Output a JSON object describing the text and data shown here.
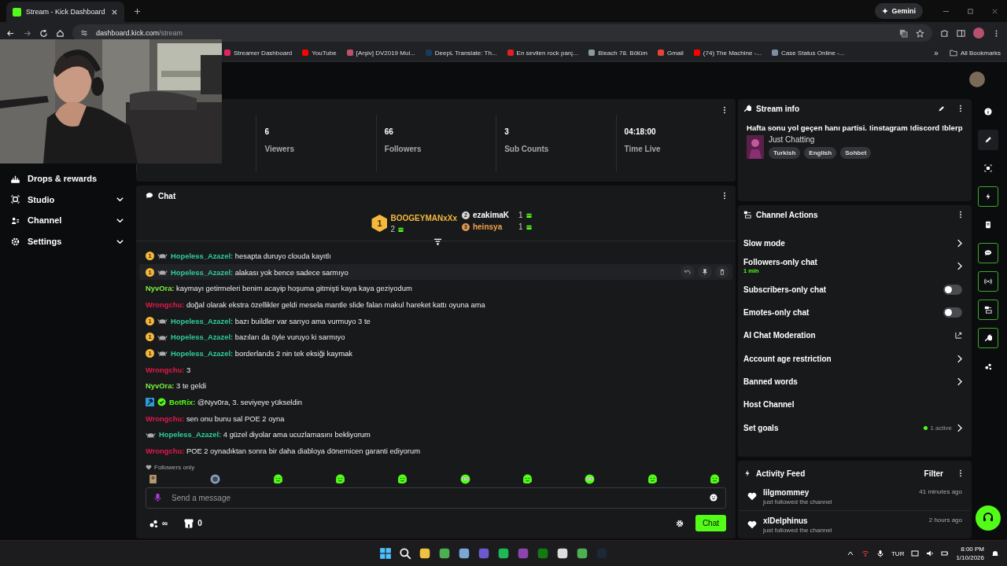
{
  "browser": {
    "tab_title": "Stream - Kick Dashboard",
    "url_host": "dashboard.kick.com",
    "url_path": "/stream",
    "gemini": "Gemini",
    "bookmarks": [
      {
        "title": "Streamer Dashboard",
        "color": "#e0245e"
      },
      {
        "title": "YouTube",
        "color": "#ff0000"
      },
      {
        "title": "[Arşiv] DV2019 Mul...",
        "color": "#c0506a"
      },
      {
        "title": "DeepL Translate: Th...",
        "color": "#1b3a5c"
      },
      {
        "title": "En sevilen rock parç...",
        "color": "#e02020"
      },
      {
        "title": "Bleach 78. Bölüm",
        "color": "#8a9aa0"
      },
      {
        "title": "Gmail",
        "color": "#ea4335"
      },
      {
        "title": "(74) The Machine -...",
        "color": "#ff0000"
      },
      {
        "title": "Case Status Online -...",
        "color": "#7a8fa6"
      }
    ],
    "more": "»",
    "all_bookmarks": "All Bookmarks"
  },
  "sidebar": [
    {
      "label": "Drops & rewards",
      "kind": "link"
    },
    {
      "label": "Studio",
      "kind": "group",
      "expanded": false
    },
    {
      "label": "Channel",
      "kind": "group",
      "expanded": false
    },
    {
      "label": "Settings",
      "kind": "group",
      "expanded": false
    }
  ],
  "stats": [
    {
      "value": "6",
      "label": "Viewers"
    },
    {
      "value": "66",
      "label": "Followers"
    },
    {
      "value": "3",
      "label": "Sub Counts"
    },
    {
      "value": "04:18:00",
      "label": "Time Live"
    }
  ],
  "chat": {
    "title": "Chat",
    "leaders": [
      {
        "rank": "1",
        "name": "BOOGEYMANxXx",
        "count": "2",
        "color": "#f5b83d"
      },
      {
        "rank": "2",
        "name": "ezakimaK",
        "count": "1",
        "color": "#ffffff"
      },
      {
        "rank": "3",
        "name": "heinsya",
        "count": "1",
        "color": "#f0a04b"
      }
    ],
    "messages": [
      {
        "sub": "1",
        "gifter": true,
        "name": "Hopeless_Azazel:",
        "color": "#2ecc9a",
        "text": "hesapta duruyo clouda kayıtlı",
        "hovered": false
      },
      {
        "sub": "1",
        "gifter": true,
        "name": "Hopeless_Azazel:",
        "color": "#2ecc9a",
        "text": "alakası yok bence sadece sarmıyo",
        "hovered": true
      },
      {
        "name": "NyvOra:",
        "color": "#7df23c",
        "text": "kaymayı getirmeleri benim acayip hoşuma gitmişti kaya kaya geziyodum",
        "hovered": false
      },
      {
        "name": "Wrongchu:",
        "color": "#e5194b",
        "text": "doğal olarak ekstra özellikler geldi mesela mantle slide falan makul hareket kattı oyuna ama",
        "hovered": false
      },
      {
        "sub": "1",
        "gifter": true,
        "name": "Hopeless_Azazel:",
        "color": "#2ecc9a",
        "text": "bazı buildler var sarıyo ama vurmuyo 3 te",
        "hovered": false
      },
      {
        "sub": "1",
        "gifter": true,
        "name": "Hopeless_Azazel:",
        "color": "#2ecc9a",
        "text": "bazıları da öyle vuruyo ki sarmıyo",
        "hovered": false
      },
      {
        "sub": "1",
        "gifter": true,
        "name": "Hopeless_Azazel:",
        "color": "#2ecc9a",
        "text": "borderlands 2 nin tek eksiği kaymak",
        "hovered": false
      },
      {
        "name": "Wrongchu:",
        "color": "#e5194b",
        "text": "3",
        "hovered": false
      },
      {
        "name": "NyvOra:",
        "color": "#7df23c",
        "text": "3 te geldi",
        "hovered": false
      },
      {
        "bot": true,
        "name": "BotRix:",
        "color": "#53fc18",
        "text": "@Nyv0ra, 3. seviyeye yükseldin",
        "hovered": false
      },
      {
        "name": "Wrongchu:",
        "color": "#e5194b",
        "text": "sen onu bunu sal POE 2 oyna",
        "hovered": false
      },
      {
        "gifter": true,
        "name": "Hopeless_Azazel:",
        "color": "#2ecc9a",
        "text": "4 güzel diyolar ama ucuzlamasını bekliyorum",
        "hovered": false
      },
      {
        "name": "Wrongchu:",
        "color": "#e5194b",
        "text": "POE 2 oynadıktan sonra bir daha diabloya dönemicen garanti ediyorum",
        "hovered": false
      }
    ],
    "restriction": "Followers only",
    "placeholder": "Send a message",
    "points": "∞",
    "store_count": "0",
    "send": "Chat"
  },
  "stream_info": {
    "title": "Stream info",
    "stream_title": "Hafta sonu yol geçen hanı partisi. !instagram !discord !blerp",
    "category": "Just Chatting",
    "tags": [
      "Turkish",
      "English",
      "Sohbet"
    ]
  },
  "channel_actions": {
    "title": "Channel Actions",
    "items": [
      {
        "label": "Slow mode",
        "kind": "link"
      },
      {
        "label": "Followers-only chat",
        "kind": "link",
        "detail": "1 min"
      },
      {
        "label": "Subscribers-only chat",
        "kind": "toggle",
        "on": false
      },
      {
        "label": "Emotes-only chat",
        "kind": "toggle",
        "on": false
      },
      {
        "label": "AI Chat Moderation",
        "kind": "external"
      },
      {
        "label": "Account age restriction",
        "kind": "link"
      },
      {
        "label": "Banned words",
        "kind": "link"
      },
      {
        "label": "Host Channel",
        "kind": "plain"
      },
      {
        "label": "Set goals",
        "kind": "link",
        "status": "1 active"
      }
    ]
  },
  "activity": {
    "title": "Activity Feed",
    "filter": "Filter",
    "items": [
      {
        "user": "lilgmommey",
        "text": "just followed the channel",
        "time": "41 minutes ago"
      },
      {
        "user": "xlDelphinus",
        "text": "just followed the channel",
        "time": "2 hours ago"
      }
    ]
  },
  "rail": [
    {
      "active": false,
      "selected": false
    },
    {
      "active": false,
      "selected": true
    },
    {
      "active": false,
      "selected": false
    },
    {
      "active": true,
      "selected": false
    },
    {
      "active": false,
      "selected": false
    },
    {
      "active": true,
      "selected": false
    },
    {
      "active": true,
      "selected": false
    },
    {
      "active": true,
      "selected": false
    },
    {
      "active": true,
      "selected": false
    },
    {
      "active": false,
      "selected": false
    }
  ],
  "taskbar": {
    "language": "TUR",
    "time": "8:00 PM",
    "date": "1/10/2026"
  }
}
